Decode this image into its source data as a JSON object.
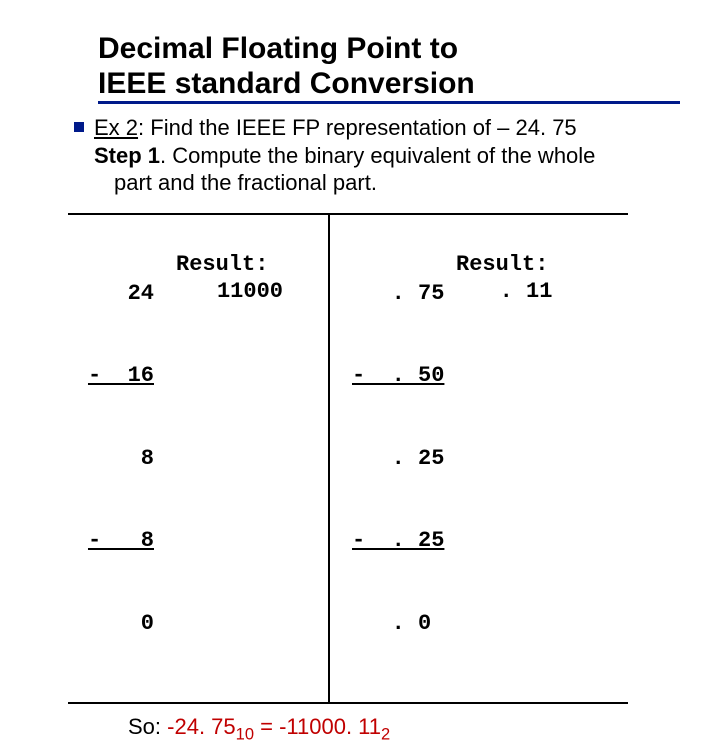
{
  "title_line1": "Decimal Floating Point to",
  "title_line2": "IEEE standard Conversion",
  "ex_label": "Ex 2",
  "ex_text": ": Find the IEEE FP representation of   – 24. 75",
  "step_label": "Step 1",
  "step_text_a": ".  Compute the binary equivalent of the whole",
  "step_text_b": "part and the fractional part.",
  "left_nums": {
    "l1": "   24",
    "l2": "-  16",
    "l3": "    8",
    "l4": "-   8",
    "l5": "    0"
  },
  "left_result_label": "Result:",
  "left_result_value": "11000",
  "right_nums": {
    "l1": "   . 75",
    "l2": "-  . 50",
    "l3": "   . 25",
    "l4": "-  . 25",
    "l5": "   . 0"
  },
  "right_result_label": "Result:",
  "right_result_value": ". 11",
  "so_label": "So:  ",
  "so_lhs": "-24. 75",
  "so_lsub": "10",
  "so_eq": " = ",
  "so_rhs": "-11000. 11",
  "so_rsub": "2"
}
